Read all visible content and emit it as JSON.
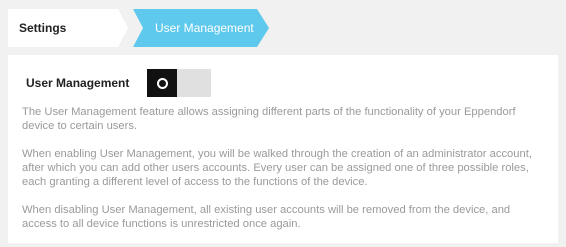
{
  "breadcrumb": {
    "items": [
      {
        "label": "Settings"
      },
      {
        "label": "User Management",
        "active": true
      }
    ]
  },
  "colors": {
    "breadcrumb_active_bg": "#5ec9ec",
    "toggle_knob": "#111111",
    "toggle_track": "#e0e0e0",
    "description_text": "#9a9a9a"
  },
  "user_management": {
    "label": "User Management",
    "toggle_state": "off",
    "toggle_icon": "power-ring-icon",
    "paragraphs": [
      "The User Management feature allows assigning different parts of the functionality of your Eppendorf device to certain users.",
      "When enabling User Management, you will be walked through the creation of an administrator account, after which you can add other users accounts. Every user can be assigned one of three possible roles, each granting a different level of access to the functions of the device.",
      "When disabling User Management, all existing user accounts will be removed from the device, and access to all device functions is unrestricted once again."
    ]
  }
}
